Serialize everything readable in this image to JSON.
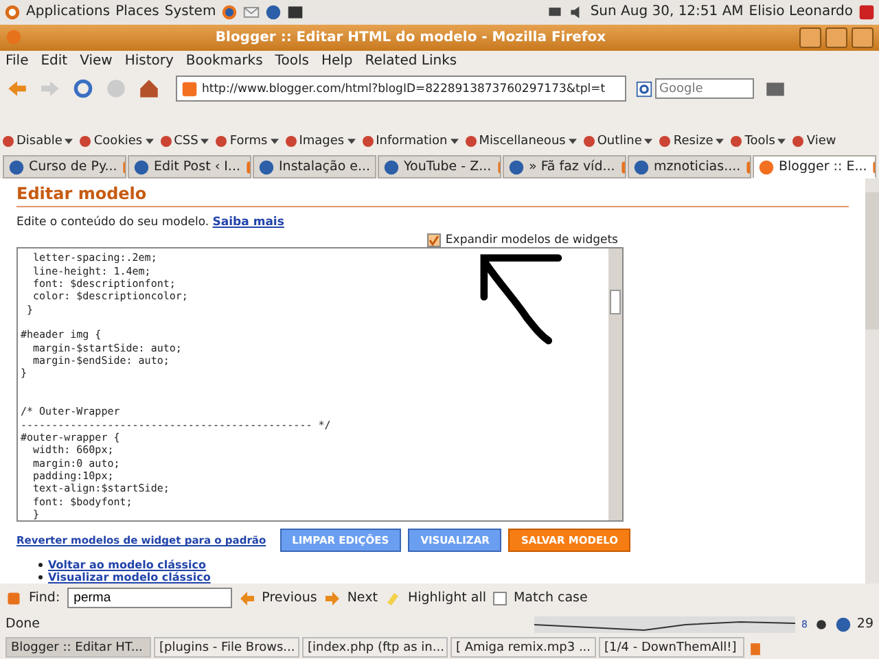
{
  "top_panel": {
    "menus": [
      "Applications",
      "Places",
      "System"
    ],
    "clock": "Sun Aug 30, 12:51 AM",
    "user": "Elisio Leonardo"
  },
  "window": {
    "title": "Blogger :: Editar HTML do modelo - Mozilla Firefox"
  },
  "menu_bar": [
    "File",
    "Edit",
    "View",
    "History",
    "Bookmarks",
    "Tools",
    "Help",
    "Related Links"
  ],
  "address_bar": {
    "value": "http://www.blogger.com/html?blogID=8228913873760297173&tpl=t"
  },
  "search": {
    "placeholder": "Google"
  },
  "dev_toolbar": [
    {
      "label": "Disable",
      "caret": true
    },
    {
      "label": "Cookies",
      "caret": true
    },
    {
      "label": "CSS",
      "caret": true
    },
    {
      "label": "Forms",
      "caret": true
    },
    {
      "label": "Images",
      "caret": true
    },
    {
      "label": "Information",
      "caret": true
    },
    {
      "label": "Miscellaneous",
      "caret": true
    },
    {
      "label": "Outline",
      "caret": true
    },
    {
      "label": "Resize",
      "caret": true
    },
    {
      "label": "Tools",
      "caret": true
    },
    {
      "label": "View",
      "caret": false
    }
  ],
  "tabs": [
    {
      "label": "Curso de Py...",
      "selected": false
    },
    {
      "label": "Edit Post ‹ I...",
      "selected": false
    },
    {
      "label": "Instalação e...",
      "selected": false
    },
    {
      "label": "YouTube - Z...",
      "selected": false
    },
    {
      "label": "» Fã faz víd...",
      "selected": false
    },
    {
      "label": "mznoticias....",
      "selected": false
    },
    {
      "label": "Blogger :: E...",
      "selected": true
    }
  ],
  "page": {
    "heading": "Editar modelo",
    "intro": "Edite o conteúdo do seu modelo.",
    "intro_link": "Saiba mais",
    "expand_widgets": {
      "label": "Expandir modelos de widgets",
      "checked": true
    },
    "code_blocks": [
      {
        "kind": "first",
        "lines": [
          "  letter-spacing:.2em;",
          "  line-height: 1.4em;",
          "  font: $descriptionfont;",
          "  color: $descriptioncolor;",
          " }"
        ]
      },
      {
        "kind": "spaced",
        "lines": [
          "#header img {",
          "  margin-$startSide: auto;",
          "  margin-$endSide: auto;",
          "}"
        ]
      },
      {
        "kind": "wide",
        "lines": [
          "/* Outer-Wrapper",
          "----------------------------------------------- */",
          "#outer-wrapper {",
          "  width: 660px;",
          "  margin:0 auto;",
          "  padding:10px;",
          "  text-align:$startSide;",
          "  font: $bodyfont;",
          "  }"
        ]
      }
    ],
    "revert_link": "Reverter modelos de widget para o padrão",
    "buttons": [
      {
        "label": "LIMPAR EDIÇÕES",
        "kind": "secondary"
      },
      {
        "label": "VISUALIZAR",
        "kind": "secondary"
      },
      {
        "label": "SALVAR MODELO",
        "kind": "primary"
      }
    ],
    "links": [
      "Voltar ao modelo clássico",
      "Visualizar modelo clássico"
    ]
  },
  "find_bar": {
    "label": "Find:",
    "value": "perma",
    "previous": "Previous",
    "next": "Next",
    "highlight": "Highlight all",
    "match_case": {
      "label": "Match case",
      "checked": false
    }
  },
  "status_bar": {
    "text": "Done",
    "count": "8",
    "number": "29"
  },
  "taskbar": [
    {
      "label": "Blogger :: Editar HT...",
      "selected": true
    },
    {
      "label": "[plugins - File Brows...",
      "selected": false
    },
    {
      "label": "[index.php (ftp as in...",
      "selected": false
    },
    {
      "label": "[ Amiga remix.mp3 ...",
      "selected": false
    },
    {
      "label": "[1/4 - DownThemAll!]",
      "selected": false
    }
  ]
}
